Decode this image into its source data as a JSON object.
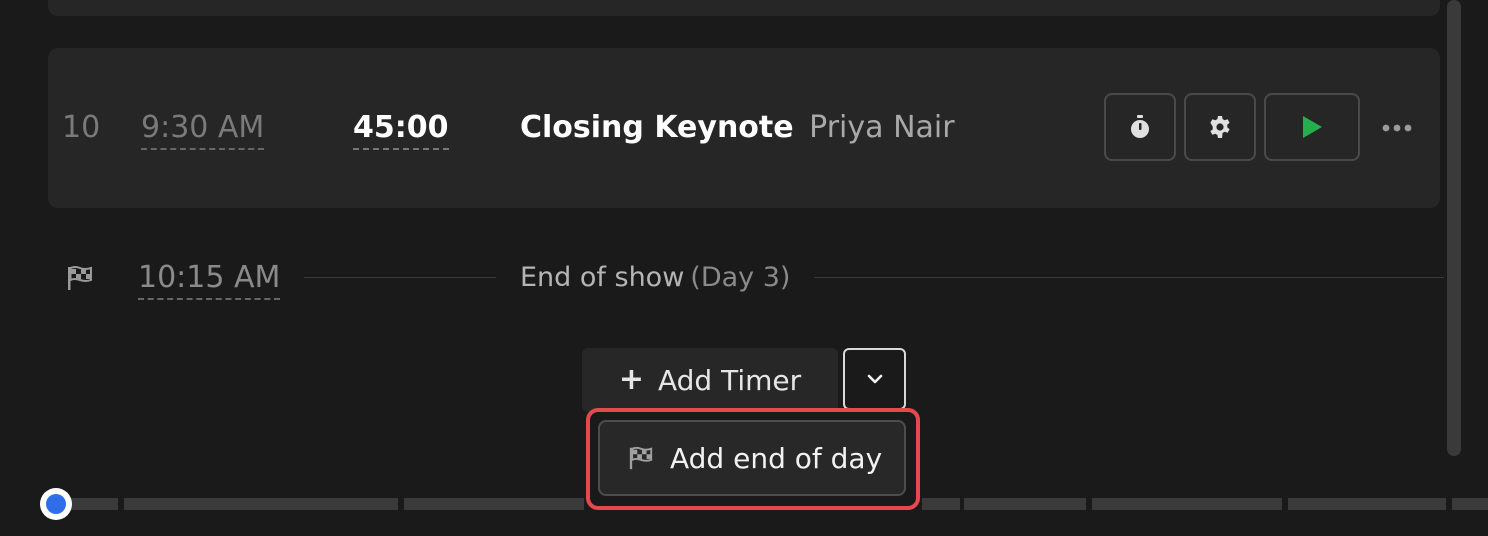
{
  "timer": {
    "cue_number": "10",
    "start_time": "9:30 AM",
    "duration": "45:00",
    "title": "Closing Keynote",
    "speaker": "Priya Nair",
    "actions": {
      "timer_icon": "stopwatch-icon",
      "settings_icon": "gear-icon",
      "play_icon": "play-icon",
      "more_icon": "more-horizontal-icon"
    },
    "colors": {
      "play": "#22b14c"
    }
  },
  "end_of_show": {
    "icon": "checkered-flag-icon",
    "time": "10:15 AM",
    "label": "End of show",
    "day": "(Day 3)"
  },
  "add_timer": {
    "icon": "plus-icon",
    "label": "Add Timer",
    "dropdown_icon": "chevron-down-icon"
  },
  "menu": {
    "items": [
      {
        "icon": "checkered-flag-icon",
        "label": "Add end of day"
      }
    ],
    "highlight_color": "#e5484d"
  },
  "progress": {
    "knob_color": "#2f6ee8"
  }
}
